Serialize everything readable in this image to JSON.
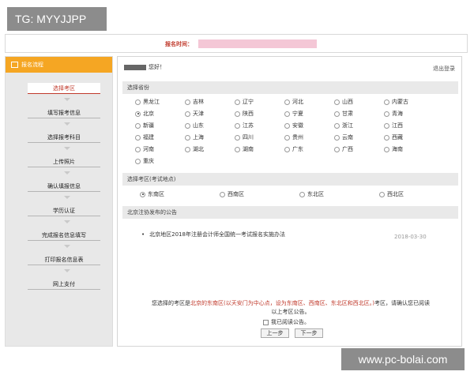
{
  "watermark_tag": "TG: MYYJJPP",
  "watermark_site": "www.pc-bolai.com",
  "header": {
    "time_label": "报名时间："
  },
  "sidebar": {
    "title": "报名流程",
    "steps": [
      "选择考区",
      "填写报考信息",
      "选择报考科目",
      "上传照片",
      "确认填报信息",
      "学历认证",
      "完成报名信息填写",
      "打印报名信息表",
      "网上支付"
    ],
    "active_step": 0
  },
  "main": {
    "greeting": "您好！",
    "logout": "退出登录",
    "province_title": "选择省份",
    "provinces": [
      "黑龙江",
      "吉林",
      "辽宁",
      "河北",
      "山西",
      "内蒙古",
      "北京",
      "天津",
      "陕西",
      "宁夏",
      "甘肃",
      "青海",
      "新疆",
      "山东",
      "江苏",
      "安徽",
      "浙江",
      "江西",
      "福建",
      "上海",
      "四川",
      "贵州",
      "云南",
      "西藏",
      "河南",
      "湖北",
      "湖南",
      "广东",
      "广西",
      "海南",
      "重庆"
    ],
    "selected_province": "北京",
    "region_title": "选择考区(考试地点)",
    "regions": [
      "东南区",
      "西南区",
      "东北区",
      "西北区"
    ],
    "selected_region": "东南区",
    "notice_title": "北京注协发布的公告",
    "notice_item": "北京地区2018年注册会计师全国统一考试报名实施办法",
    "notice_date": "2018-03-30",
    "confirm_p1": "您选择的考区是",
    "confirm_p2": "北京的东南区(以天安门为中心点，设为东南区、西南区、东北区和西北区。)",
    "confirm_p3": "考区，请确认您已阅读",
    "confirm_p4": "以上考区公告。",
    "agree_label": "我已阅读公告。",
    "prev_button": "上一步",
    "next_button": "下一步"
  }
}
